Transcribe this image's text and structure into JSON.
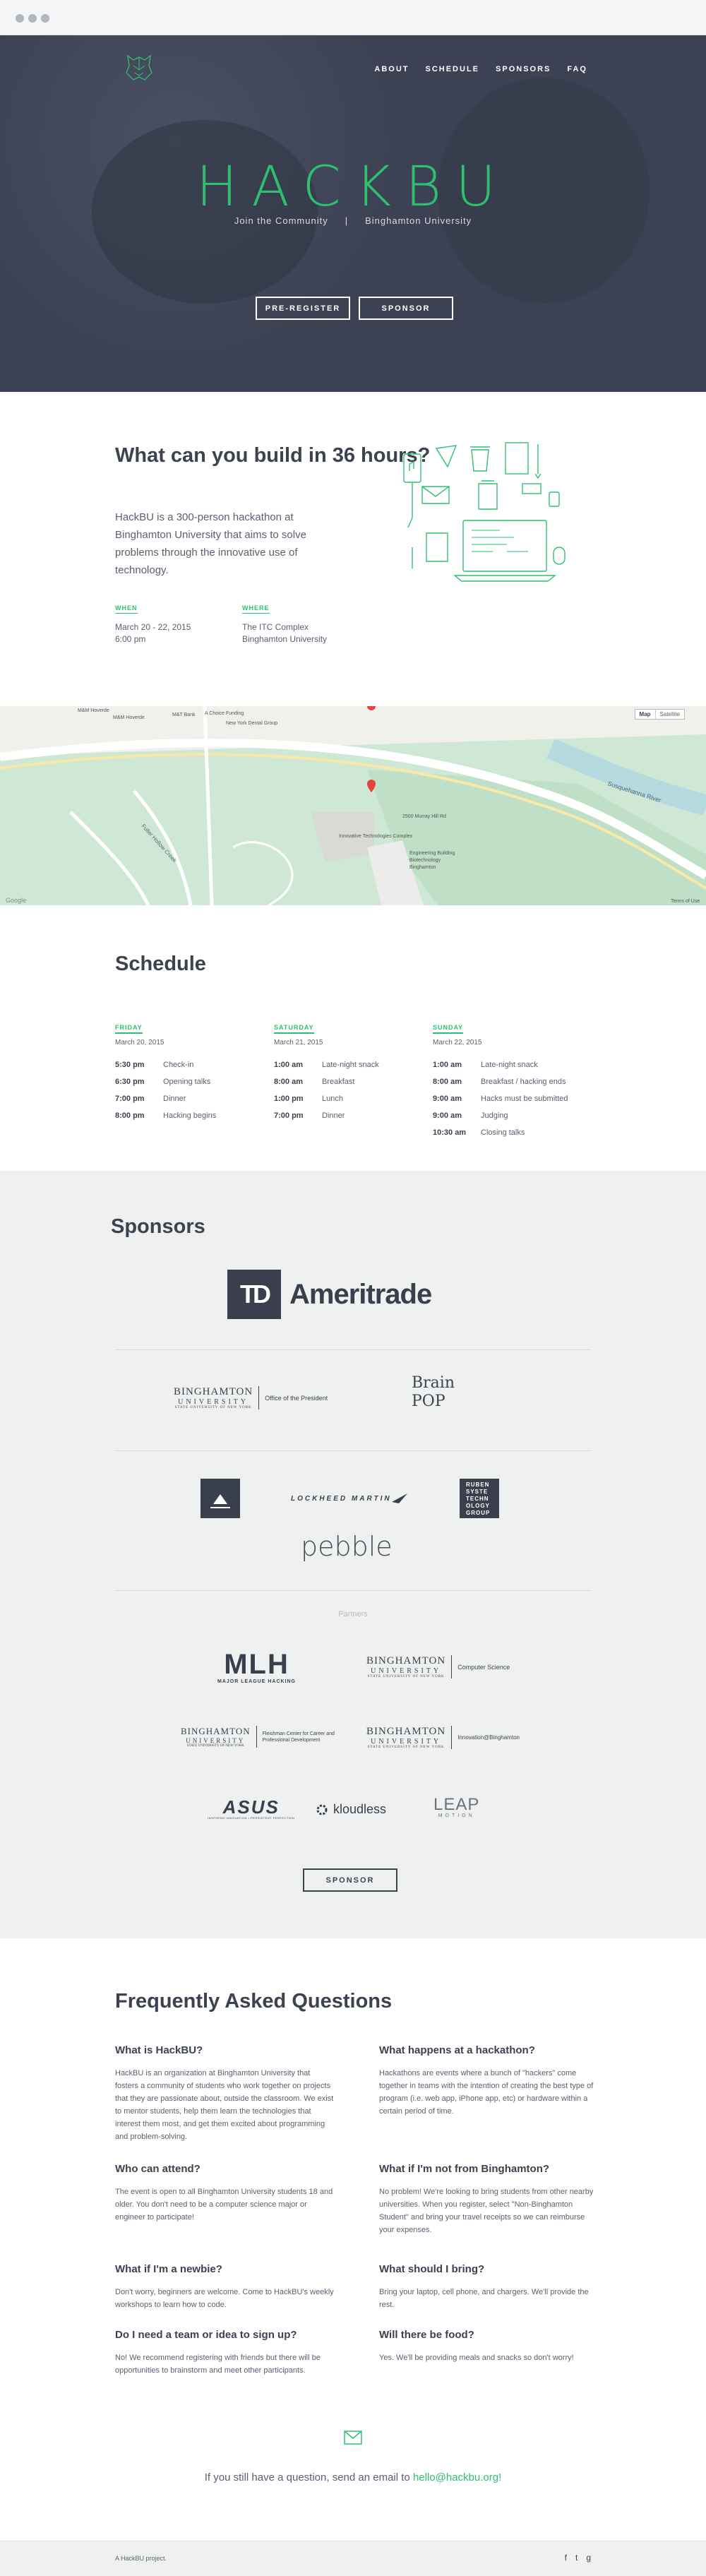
{
  "nav": {
    "items": [
      "ABOUT",
      "SCHEDULE",
      "SPONSORS",
      "FAQ"
    ]
  },
  "hero": {
    "title": "HACKBU",
    "sub_left": "Join the Community",
    "sub_sep": "|",
    "sub_right": "Binghamton University",
    "preregister": "PRE-REGISTER",
    "sponsor": "SPONSOR"
  },
  "about": {
    "heading": "What can you build in 36 hours?",
    "intro": "HackBU is a 300-person hackathon at Binghamton University that aims to solve problems through the innovative use of technology.",
    "when_label": "WHEN",
    "when_line1": "March 20 - 22, 2015",
    "when_line2": "6:00 pm",
    "where_label": "WHERE",
    "where_line1": "The ITC Complex",
    "where_line2": "Binghamton University"
  },
  "map": {
    "map_btn": "Map",
    "sat_btn": "Satellite",
    "labels": [
      "M&M Hoverde",
      "M&M Hoverde",
      "M&T Bank",
      "A Choice Funding",
      "New York Dental Group",
      "Innovative Technologies Complex",
      "2500 Murray Hill Rd",
      "Engineering Building",
      "Biotechnology",
      "Binghamton",
      "Susquehanna River",
      "Fuller Hollow Creek",
      "Terms of Use",
      "Google"
    ]
  },
  "schedule": {
    "heading": "Schedule",
    "days": [
      {
        "name": "FRIDAY",
        "date": "March 20, 2015",
        "events": [
          [
            "5:30 pm",
            "Check-in"
          ],
          [
            "6:30 pm",
            "Opening talks"
          ],
          [
            "7:00 pm",
            "Dinner"
          ],
          [
            "8:00 pm",
            "Hacking begins"
          ]
        ]
      },
      {
        "name": "SATURDAY",
        "date": "March 21, 2015",
        "events": [
          [
            "1:00 am",
            "Late-night snack"
          ],
          [
            "8:00 am",
            "Breakfast"
          ],
          [
            "1:00 pm",
            "Lunch"
          ],
          [
            "7:00 pm",
            "Dinner"
          ]
        ]
      },
      {
        "name": "SUNDAY",
        "date": "March 22, 2015",
        "events": [
          [
            "1:00 am",
            "Late-night snack"
          ],
          [
            "8:00 am",
            "Breakfast / hacking ends"
          ],
          [
            "9:00 am",
            "Hacks must be submitted"
          ],
          [
            "9:00 am",
            "Judging"
          ],
          [
            "10:30 am",
            "Closing talks"
          ]
        ]
      }
    ]
  },
  "sponsors": {
    "heading": "Sponsors",
    "td_mark": "TD",
    "ameritrade": "Ameritrade",
    "binghamton": "BINGHAMTON",
    "university": "UNIVERSITY",
    "suny": "STATE UNIVERSITY OF NEW YORK",
    "president": "Office of the President",
    "brainpop": "Brain POP",
    "lockheed": "LOCKHEED MARTIN",
    "ruben": [
      "RUBEN",
      "SYSTE",
      "TECHN",
      "OLOGY",
      "GROUP"
    ],
    "pebble": "pebble",
    "partners_label": "Partners",
    "mlh": "MLH",
    "mlh_sub": "MAJOR LEAGUE HACKING",
    "computer_science": "Computer Science",
    "fleishman": "Fleishman Center for Career and Professional Development",
    "innovation": "Innovation@Binghamton",
    "asus": "ASUS",
    "asus_sub": "INSPIRING INNOVATION • PERSISTENT PERFECTION",
    "kloudless": "kloudless",
    "leap": "LEAP",
    "leap_sub": "MOTION",
    "sponsor_btn": "SPONSOR"
  },
  "faq": {
    "heading": "Frequently Asked Questions",
    "items": [
      {
        "q": "What is HackBU?",
        "a": "HackBU is an organization at Binghamton University that fosters a community of students who work together on projects that they are passionate about, outside the classroom. We exist to mentor students, help them learn the technologies that interest them most, and get them excited about programming and problem-solving."
      },
      {
        "q": "What happens at a hackathon?",
        "a": "Hackathons are events where a bunch of \"hackers\" come together in teams with the intention of creating the best type of program (i.e. web app, iPhone app, etc) or hardware within a certain period of time."
      },
      {
        "q": "Who can attend?",
        "a": "The event is open to all Binghamton University students 18 and older. You don't need to be a computer science major or engineer to participate!"
      },
      {
        "q": "What if I'm not from Binghamton?",
        "a": "No problem! We're looking to bring students from other nearby universities. When you register, select \"Non-Binghamton Student\" and bring your travel receipts so we can reimburse your expenses."
      },
      {
        "q": "What if I'm a newbie?",
        "a": "Don't worry, beginners are welcome. Come to HackBU's weekly workshops to learn how to code."
      },
      {
        "q": "What should I bring?",
        "a": "Bring your laptop, cell phone, and chargers. We'll provide the rest."
      },
      {
        "q": "Do I need a team or idea to sign up?",
        "a": "No! We recommend registering with friends but there will be opportunities to brainstorm and meet other participants."
      },
      {
        "q": "Will there be food?",
        "a": "Yes. We'll be providing meals and snacks so don't worry!"
      }
    ]
  },
  "contact": {
    "text": "If you still have a question, send an email to ",
    "email": "hello@hackbu.org!"
  },
  "footer": {
    "text": "A HackBU project.",
    "icons": [
      "f",
      "t",
      "g"
    ]
  },
  "colors": {
    "accent": "#2fbf71",
    "dark": "#3c4253",
    "light": "#eff1f1"
  }
}
